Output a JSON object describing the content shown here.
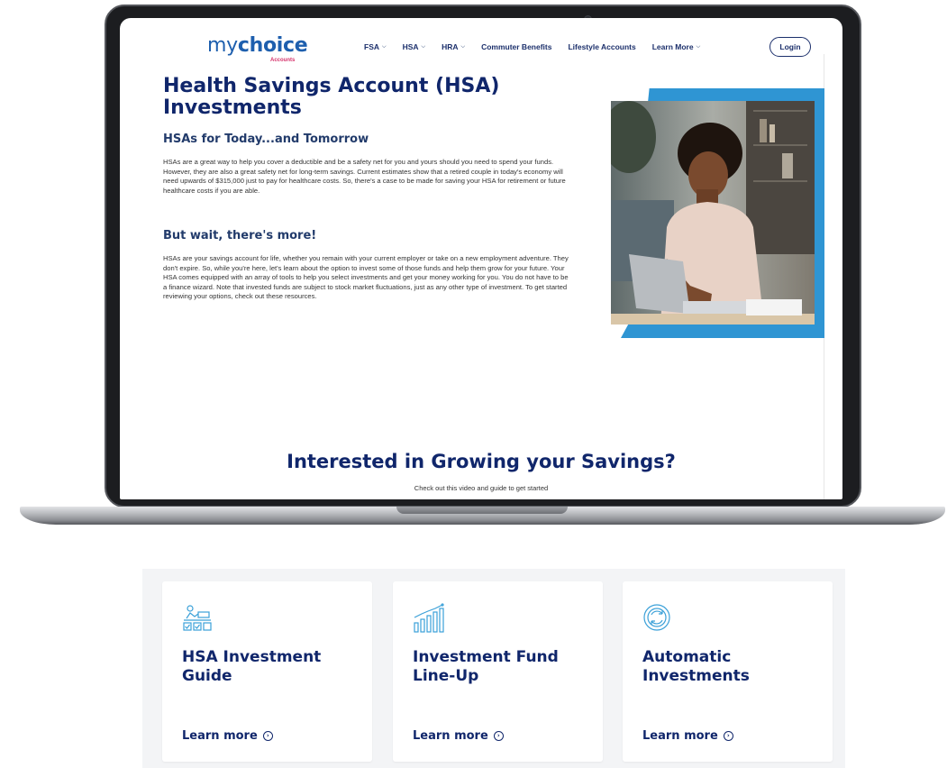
{
  "brand": {
    "logo_word": "mychoice",
    "logo_prefix": "my",
    "logo_suffix": "choice",
    "logo_sub": "Accounts"
  },
  "nav": {
    "items": [
      {
        "label": "FSA",
        "has_dropdown": true
      },
      {
        "label": "HSA",
        "has_dropdown": true
      },
      {
        "label": "HRA",
        "has_dropdown": true
      },
      {
        "label": "Commuter Benefits",
        "has_dropdown": false
      },
      {
        "label": "Lifestyle Accounts",
        "has_dropdown": false
      },
      {
        "label": "Learn More",
        "has_dropdown": true
      }
    ],
    "login_label": "Login"
  },
  "main": {
    "title": "Health Savings Account (HSA) Investments",
    "section1_heading": "HSAs for Today...and Tomorrow",
    "section1_text": "HSAs are a great way to help you cover a deductible and be a safety net for you and yours should you need to spend your funds. However, they are also a great safety net for long-term savings. Current estimates show that a retired couple in today's economy will need upwards of $315,000 just to pay for healthcare costs. So, there's a case to be made for saving your HSA for retirement or future healthcare costs if you are able.",
    "section2_heading": "But wait, there's more!",
    "section2_text": "HSAs are your savings account for life, whether you remain with your current employer or take on a new employment adventure. They don't expire. So, while you're here, let's learn about the option to invest some of those funds and help them grow for your future. Your HSA comes equipped with an array of tools to help you select investments and get your money working for you. You do not have to be a finance wizard. Note that invested funds are subject to stock market fluctuations, just as any other type of investment. To get started reviewing your options, check out these resources.",
    "cta_title": "Interested in Growing your Savings?",
    "cta_subtitle": "Check out this video and guide to get started"
  },
  "cards": [
    {
      "title": "HSA Investment Guide",
      "link": "Learn more",
      "icon": "checklist-person-icon"
    },
    {
      "title": "Investment Fund Line-Up",
      "link": "Learn more",
      "icon": "growth-chart-icon"
    },
    {
      "title": "Automatic Investments",
      "link": "Learn more",
      "icon": "auto-refresh-icon"
    }
  ],
  "colors": {
    "brand_navy": "#10266b",
    "brand_blue": "#1e5fae",
    "accent_blue": "#2f95d3",
    "accent_pink": "#d6336c",
    "icon_blue": "#3aa0d8"
  }
}
